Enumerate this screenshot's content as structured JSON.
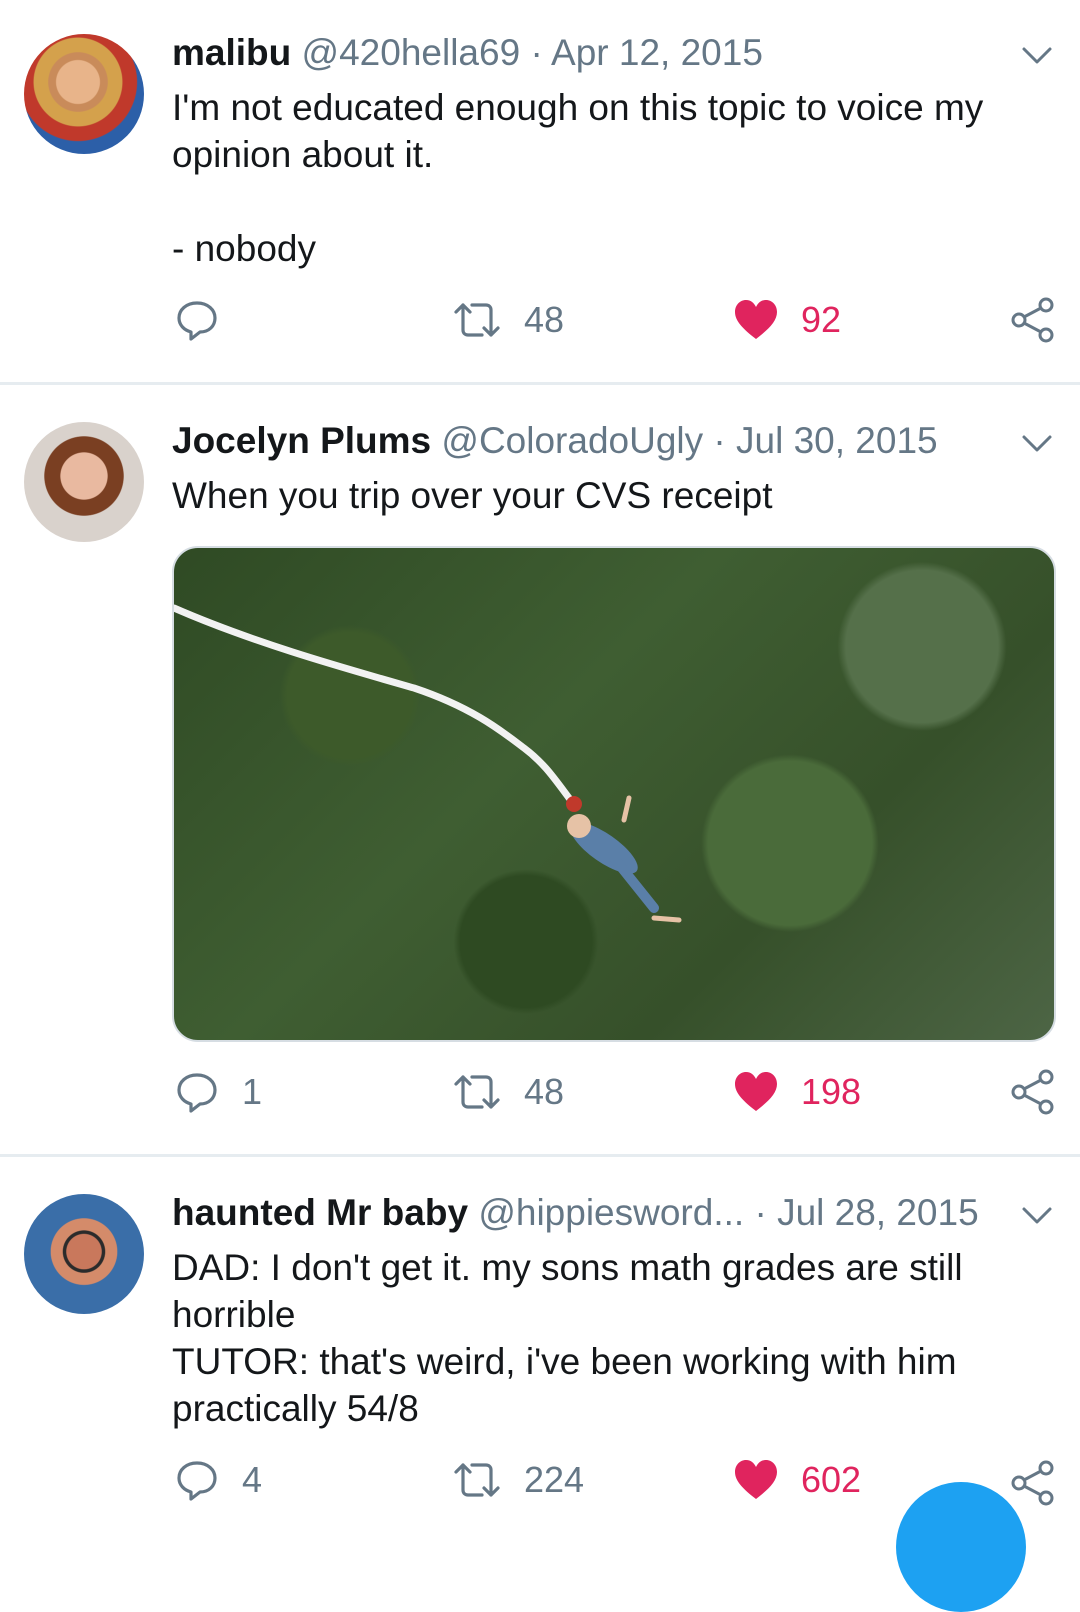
{
  "tweets": [
    {
      "name": "malibu",
      "handle": "@420hella69",
      "date": "Apr 12, 2015",
      "text": "I'm not educated enough on this topic to voice my opinion about it.\n\n- nobody",
      "replies": "",
      "retweets": "48",
      "likes": "92"
    },
    {
      "name": "Jocelyn Plums",
      "handle": "@ColoradoUgly",
      "date": "Jul 30, 2015",
      "text": "When you trip over your CVS receipt",
      "replies": "1",
      "retweets": "48",
      "likes": "198"
    },
    {
      "name": "haunted Mr baby",
      "handle": "@hippiesword...",
      "date": "Jul 28, 2015",
      "text": "DAD: I don't get it. my sons math grades are still horrible\nTUTOR: that's weird, i've been working with him practically 54/8",
      "replies": "4",
      "retweets": "224",
      "likes": "602"
    }
  ],
  "colors": {
    "like": "#e0245e",
    "icon_gray": "#657786",
    "accent": "#1da1f2"
  },
  "icons": [
    "reply-icon",
    "retweet-icon",
    "heart-icon",
    "share-icon",
    "chevron-down-icon"
  ]
}
